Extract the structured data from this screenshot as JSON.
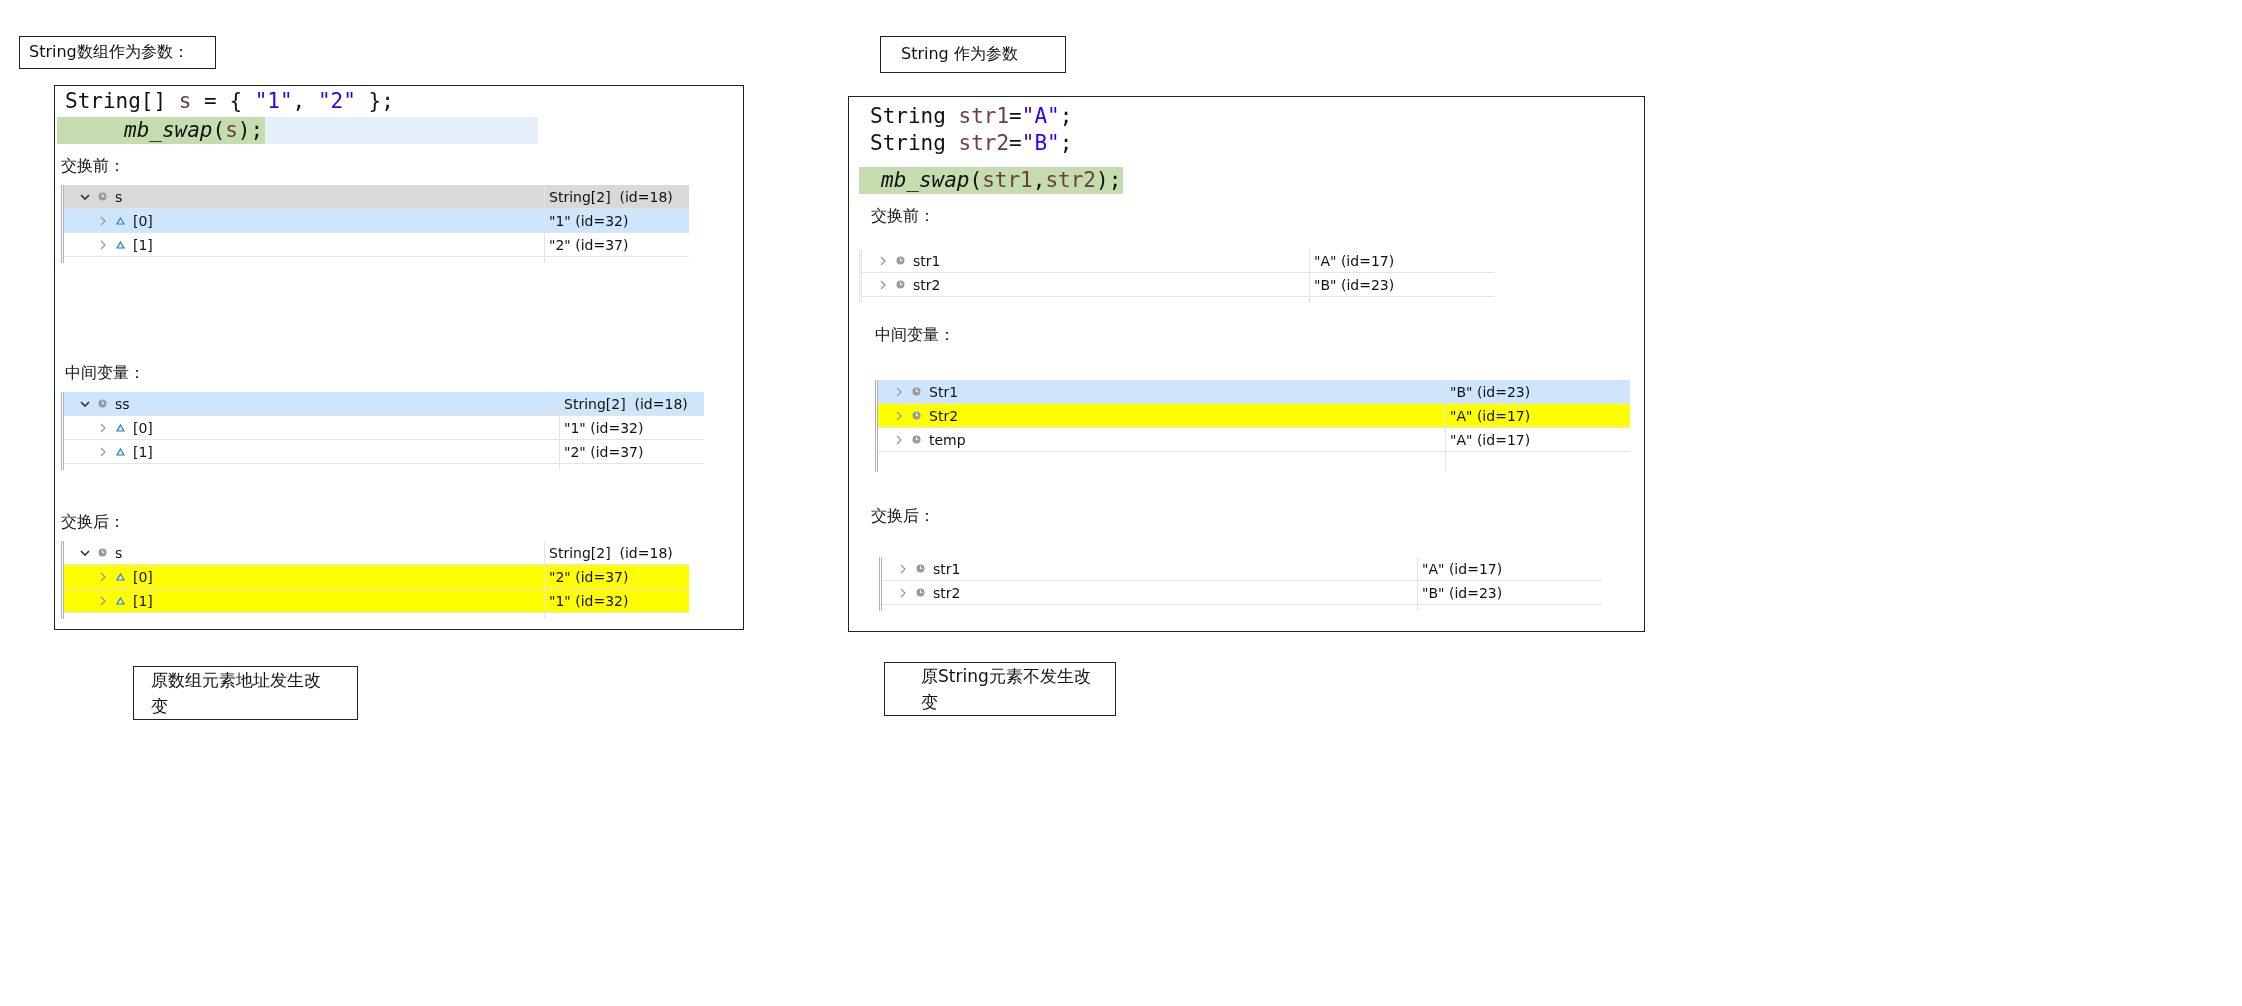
{
  "sections": [
    {
      "title": "String数组作为参数：",
      "code": [
        {
          "highlighted": false,
          "current": false,
          "tokens": [
            {
              "kind": "type",
              "text": "String[] "
            },
            {
              "kind": "variable",
              "text": "s"
            },
            {
              "kind": "plain",
              "text": " = { "
            },
            {
              "kind": "string",
              "text": "\"1\""
            },
            {
              "kind": "plain",
              "text": ", "
            },
            {
              "kind": "string",
              "text": "\"2\""
            },
            {
              "kind": "plain",
              "text": " };"
            }
          ]
        },
        {
          "highlighted": true,
          "current": true,
          "tokens": [
            {
              "kind": "method",
              "text": "mb_swap"
            },
            {
              "kind": "plain",
              "text": "("
            },
            {
              "kind": "variable",
              "text": "s"
            },
            {
              "kind": "plain",
              "text": ");"
            }
          ]
        }
      ],
      "stages": [
        {
          "label": "交换前：",
          "rows": [
            {
              "name": "s",
              "value": "String[2]  (id=18)",
              "kind": "variable",
              "expanded": true,
              "color": "#d9d9d9",
              "children": [
                {
                  "name": "[0]",
                  "value": "\"1\" (id=32)",
                  "kind": "element",
                  "expanded": false,
                  "color": "#cde6fb"
                },
                {
                  "name": "[1]",
                  "value": "\"2\" (id=37)",
                  "kind": "element",
                  "expanded": false
                }
              ]
            }
          ]
        },
        {
          "label": "中间变量：",
          "rows": [
            {
              "name": "ss",
              "value": "String[2]  (id=18)",
              "kind": "variable",
              "expanded": true,
              "color": "#cde6fb",
              "children": [
                {
                  "name": "[0]",
                  "value": "\"1\" (id=32)",
                  "kind": "element",
                  "expanded": false
                },
                {
                  "name": "[1]",
                  "value": "\"2\" (id=37)",
                  "kind": "element",
                  "expanded": false
                }
              ]
            }
          ]
        },
        {
          "label": "交换后：",
          "rows": [
            {
              "name": "s",
              "value": "String[2]  (id=18)",
              "kind": "variable",
              "expanded": true,
              "children": [
                {
                  "name": "[0]",
                  "value": "\"2\" (id=37)",
                  "kind": "element",
                  "expanded": false,
                  "color": "#ffff00"
                },
                {
                  "name": "[1]",
                  "value": "\"1\" (id=32)",
                  "kind": "element",
                  "expanded": false,
                  "color": "#ffff00"
                }
              ]
            }
          ]
        }
      ],
      "note": "原数组元素地址发生改变"
    },
    {
      "title": "String 作为参数",
      "code": [
        {
          "highlighted": false,
          "current": false,
          "tokens": [
            {
              "kind": "type",
              "text": "String "
            },
            {
              "kind": "variable",
              "text": "str1"
            },
            {
              "kind": "plain",
              "text": "="
            },
            {
              "kind": "string",
              "text": "\"A\""
            },
            {
              "kind": "plain",
              "text": ";"
            }
          ]
        },
        {
          "highlighted": false,
          "current": false,
          "tokens": [
            {
              "kind": "type",
              "text": "String "
            },
            {
              "kind": "variable",
              "text": "str2"
            },
            {
              "kind": "plain",
              "text": "="
            },
            {
              "kind": "string",
              "text": "\"B\""
            },
            {
              "kind": "plain",
              "text": ";"
            }
          ]
        },
        {
          "highlighted": true,
          "current": false,
          "tokens": [
            {
              "kind": "method",
              "text": "mb_swap"
            },
            {
              "kind": "plain",
              "text": "("
            },
            {
              "kind": "variable",
              "text": "str1"
            },
            {
              "kind": "plain",
              "text": ","
            },
            {
              "kind": "variable",
              "text": "str2"
            },
            {
              "kind": "plain",
              "text": ");"
            }
          ]
        }
      ],
      "stages": [
        {
          "label": "交换前：",
          "rows": [
            {
              "name": "str1",
              "value": "\"A\" (id=17)",
              "kind": "variable",
              "expanded": false
            },
            {
              "name": "str2",
              "value": "\"B\" (id=23)",
              "kind": "variable",
              "expanded": false
            }
          ]
        },
        {
          "label": "中间变量：",
          "rows": [
            {
              "name": "Str1",
              "value": "\"B\" (id=23)",
              "kind": "variable",
              "expanded": false,
              "color": "#cde6fb"
            },
            {
              "name": "Str2",
              "value": "\"A\" (id=17)",
              "kind": "variable",
              "expanded": false,
              "color": "#ffff00"
            },
            {
              "name": "temp",
              "value": "\"A\" (id=17)",
              "kind": "variable",
              "expanded": false
            }
          ]
        },
        {
          "label": "交换后：",
          "rows": [
            {
              "name": "str1",
              "value": "\"A\" (id=17)",
              "kind": "variable",
              "expanded": false
            },
            {
              "name": "str2",
              "value": "\"B\" (id=23)",
              "kind": "variable",
              "expanded": false
            }
          ]
        }
      ],
      "note": "原String元素不发生改变"
    }
  ]
}
